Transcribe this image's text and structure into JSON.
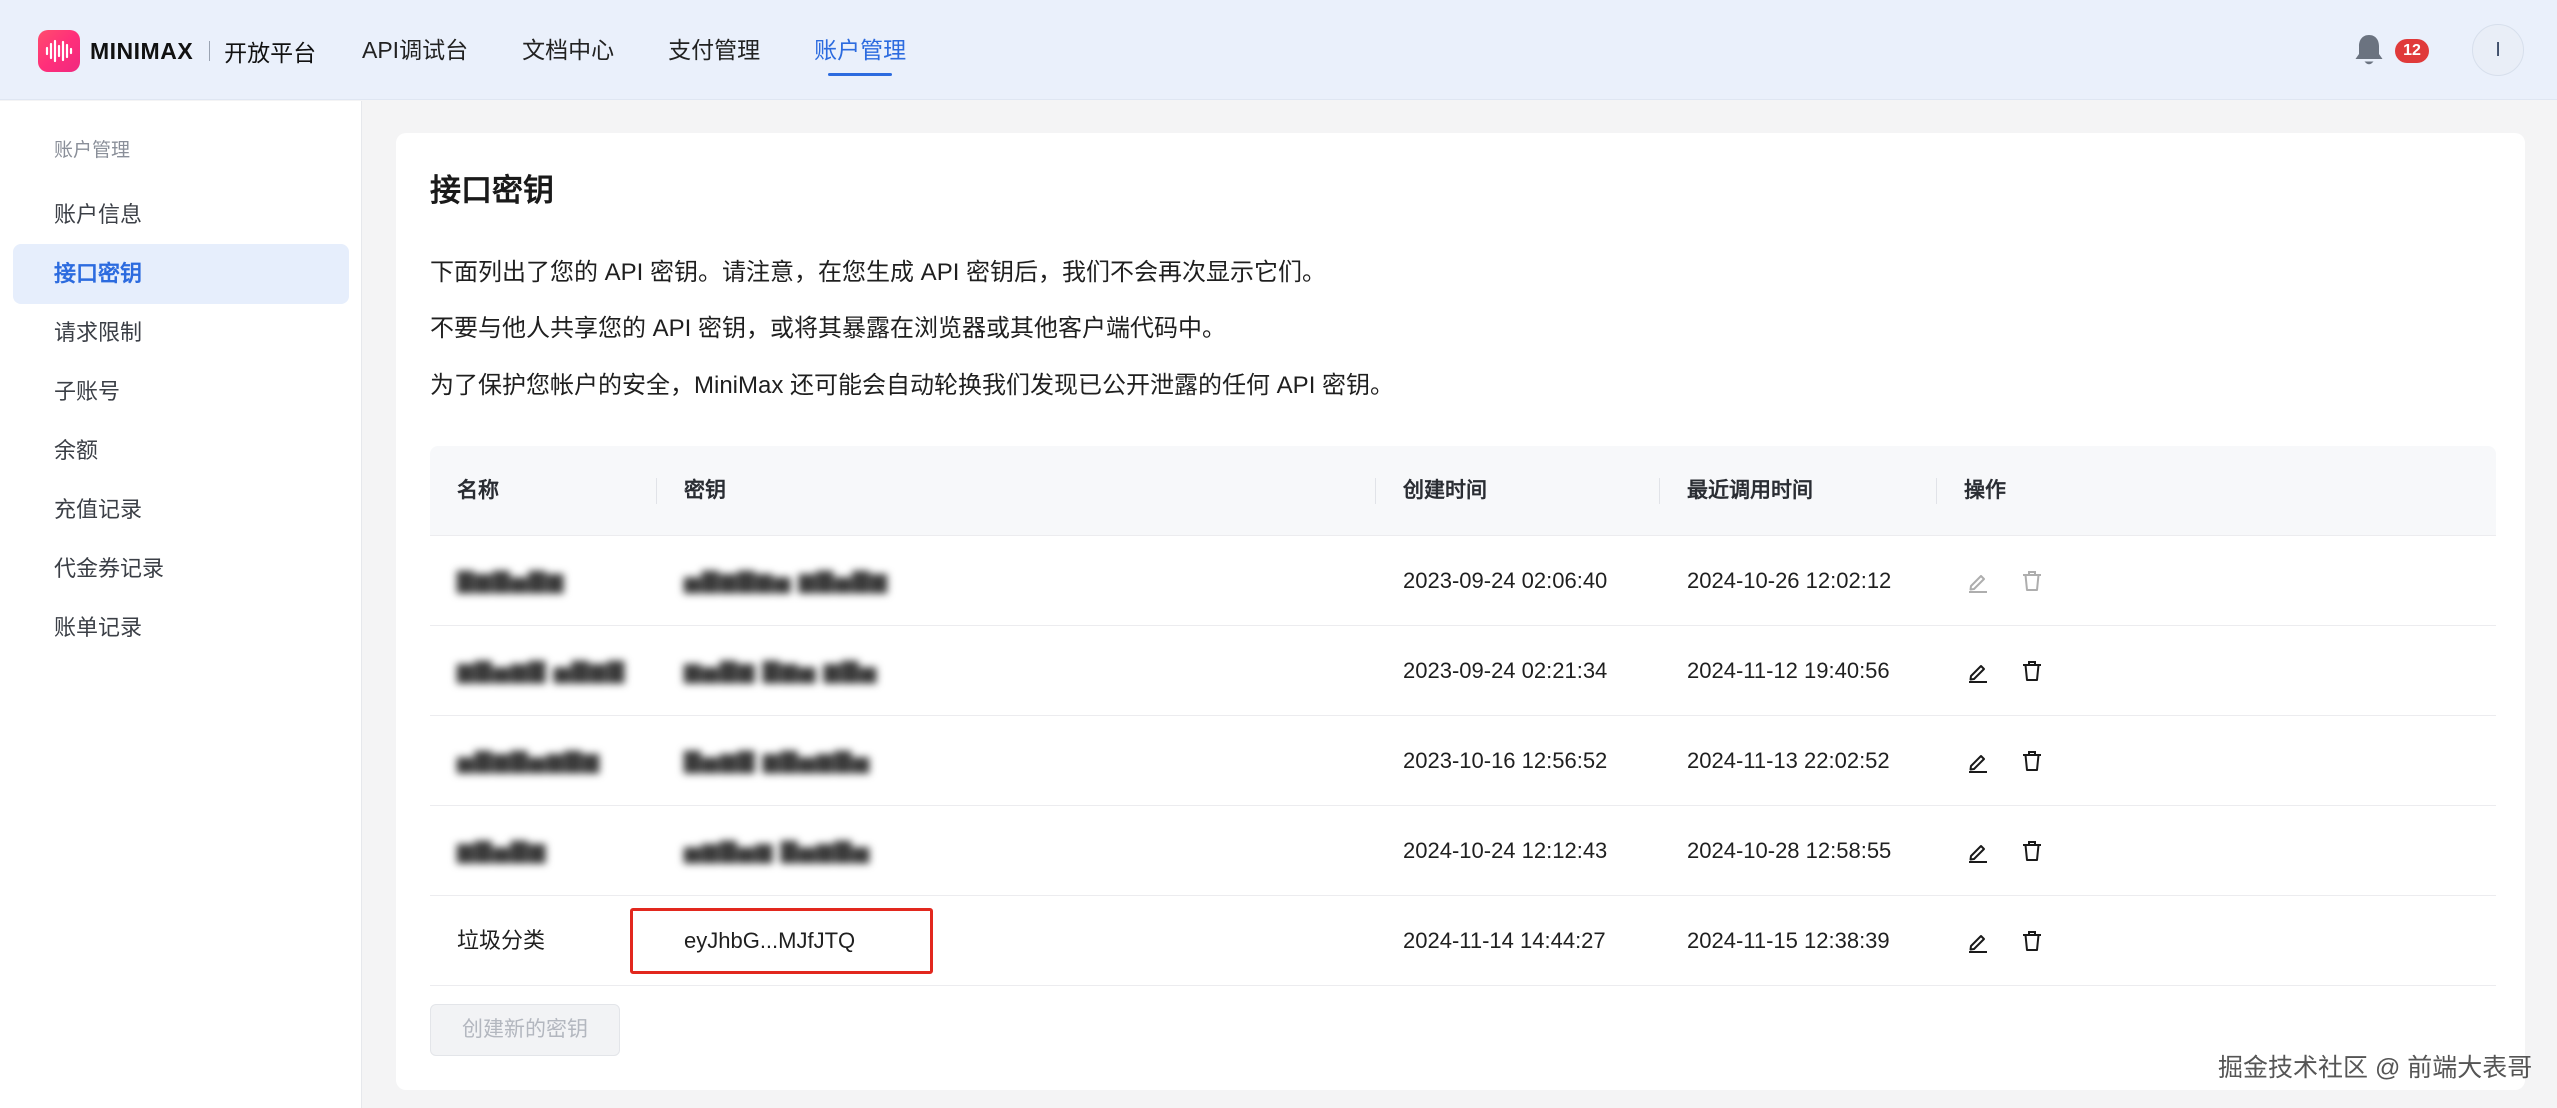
{
  "header": {
    "logo_text": "MINIMAX",
    "platform": "开放平台",
    "nav": [
      {
        "label": "API调试台",
        "active": false
      },
      {
        "label": "文档中心",
        "active": false
      },
      {
        "label": "支付管理",
        "active": false
      },
      {
        "label": "账户管理",
        "active": true
      }
    ],
    "notification_count": "12",
    "avatar_initial": "I"
  },
  "sidebar": {
    "section_title": "账户管理",
    "items": [
      {
        "label": "账户信息",
        "active": false
      },
      {
        "label": "接口密钥",
        "active": true
      },
      {
        "label": "请求限制",
        "active": false
      },
      {
        "label": "子账号",
        "active": false
      },
      {
        "label": "余额",
        "active": false
      },
      {
        "label": "充值记录",
        "active": false
      },
      {
        "label": "代金券记录",
        "active": false
      },
      {
        "label": "账单记录",
        "active": false
      }
    ]
  },
  "main": {
    "title": "接口密钥",
    "descriptions": [
      "下面列出了您的 API 密钥。请注意，在您生成 API 密钥后，我们不会再次显示它们。",
      "不要与他人共享您的 API 密钥，或将其暴露在浏览器或其他客户端代码中。",
      "为了保护您帐户的安全，MiniMax 还可能会自动轮换我们发现已公开泄露的任何 API 密钥。"
    ],
    "table": {
      "columns": [
        "名称",
        "密钥",
        "创建时间",
        "最近调用时间",
        "操作"
      ],
      "rows": [
        {
          "name": "",
          "key": "",
          "created": "2023-09-24 02:06:40",
          "last_used": "2024-10-26 12:02:12",
          "blurred": true,
          "disabled_ops": true
        },
        {
          "name": "",
          "key": "",
          "created": "2023-09-24 02:21:34",
          "last_used": "2024-11-12 19:40:56",
          "blurred": true,
          "disabled_ops": false
        },
        {
          "name": "",
          "key": "",
          "created": "2023-10-16 12:56:52",
          "last_used": "2024-11-13 22:02:52",
          "blurred": true,
          "disabled_ops": false
        },
        {
          "name": "",
          "key": "",
          "created": "2024-10-24 12:12:43",
          "last_used": "2024-10-28 12:58:55",
          "blurred": true,
          "disabled_ops": false
        },
        {
          "name": "垃圾分类",
          "key": "eyJhbG...MJfJTQ",
          "created": "2024-11-14 14:44:27",
          "last_used": "2024-11-15 12:38:39",
          "blurred": false,
          "disabled_ops": false
        }
      ]
    },
    "create_button": "创建新的密钥"
  },
  "watermark": "掘金技术社区 @ 前端大表哥",
  "colors": {
    "accent": "#2c6bdf",
    "nav_bg": "#eaf0fb",
    "badge": "#e03a3a",
    "highlight_box": "#e2281e",
    "brand_gradient_start": "#ff4d6d",
    "brand_gradient_end": "#f0287f"
  },
  "icons": {
    "logo": "waveform-logo-icon",
    "notification": "bell-icon",
    "edit": "pencil-icon",
    "delete": "trash-icon"
  }
}
